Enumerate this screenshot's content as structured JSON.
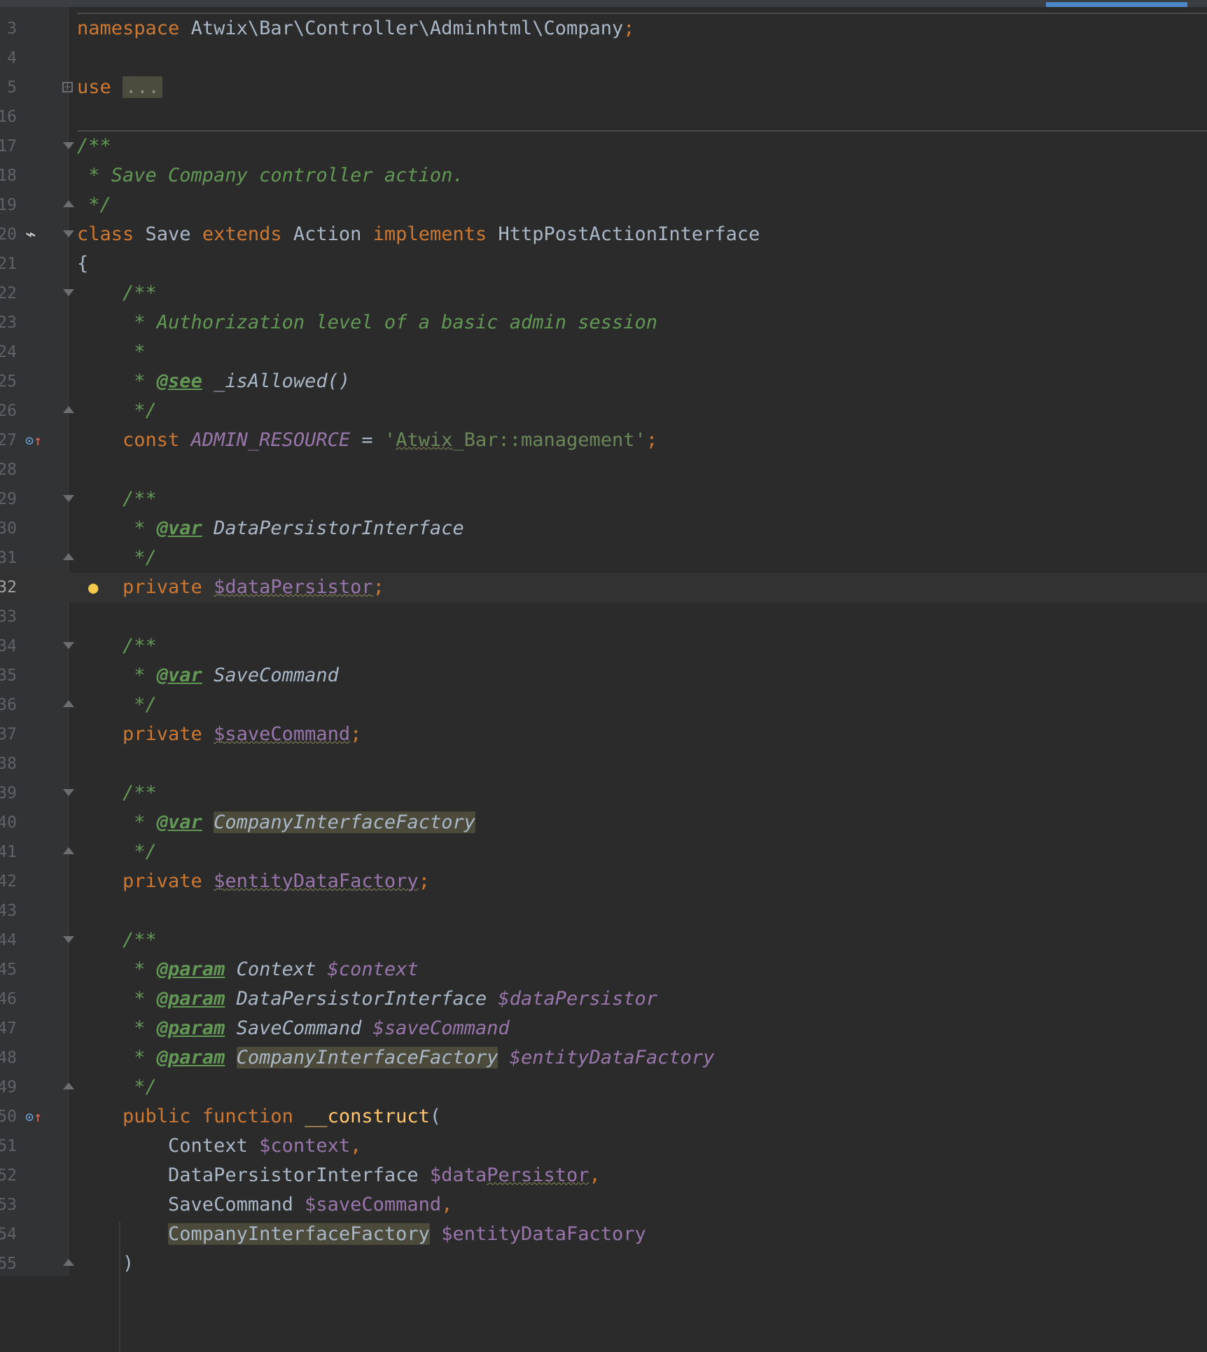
{
  "editor": {
    "lines": [
      {
        "n": "3",
        "parts": [
          [
            "kw",
            "namespace"
          ],
          [
            "t",
            " Atwix\\Bar\\Controller\\Adminhtml\\Company"
          ],
          [
            "kw",
            ";"
          ]
        ]
      },
      {
        "n": "4",
        "parts": []
      },
      {
        "n": "5",
        "fold": "box",
        "parts": [
          [
            "kw",
            "use"
          ],
          [
            "t",
            " "
          ],
          [
            "foldbox",
            "..."
          ]
        ]
      },
      {
        "n": "16",
        "parts": []
      },
      {
        "n": "17",
        "fold": "open",
        "parts": [
          [
            "cm",
            "/**"
          ]
        ]
      },
      {
        "n": "18",
        "parts": [
          [
            "cm",
            " * Save Company controller action."
          ]
        ]
      },
      {
        "n": "19",
        "fold": "close",
        "parts": [
          [
            "cm",
            " */"
          ]
        ]
      },
      {
        "n": "20",
        "icon": "plug-icon",
        "fold": "open",
        "parts": [
          [
            "kw",
            "class"
          ],
          [
            "t",
            " Save "
          ],
          [
            "kw",
            "extends"
          ],
          [
            "t",
            " Action "
          ],
          [
            "kw",
            "implements"
          ],
          [
            "t",
            " HttpPostActionInterface"
          ]
        ]
      },
      {
        "n": "21",
        "parts": [
          [
            "t",
            "{"
          ]
        ]
      },
      {
        "n": "22",
        "fold": "open",
        "parts": [
          [
            "cm",
            "    /**"
          ]
        ]
      },
      {
        "n": "23",
        "parts": [
          [
            "cm",
            "     * Authorization level of a basic admin session"
          ]
        ]
      },
      {
        "n": "24",
        "parts": [
          [
            "cm",
            "     *"
          ]
        ]
      },
      {
        "n": "25",
        "parts": [
          [
            "cm",
            "     * "
          ],
          [
            "tag",
            "@see"
          ],
          [
            "doctype",
            " _isAllowed()"
          ]
        ]
      },
      {
        "n": "26",
        "fold": "close",
        "parts": [
          [
            "cm",
            "     */"
          ]
        ]
      },
      {
        "n": "27",
        "icon": "override-icon",
        "parts": [
          [
            "kw",
            "    const "
          ],
          [
            "cst",
            "ADMIN_RESOURCE"
          ],
          [
            "t",
            " = "
          ],
          [
            "str",
            "'"
          ],
          [
            "str squig",
            "Atwix"
          ],
          [
            "str",
            "_Bar::management'"
          ],
          [
            "kw",
            ";"
          ]
        ]
      },
      {
        "n": "28",
        "parts": []
      },
      {
        "n": "29",
        "fold": "open",
        "parts": [
          [
            "cm",
            "    /**"
          ]
        ]
      },
      {
        "n": "30",
        "parts": [
          [
            "cm",
            "     * "
          ],
          [
            "tag",
            "@var"
          ],
          [
            "doctype",
            " DataPersistorInterface"
          ]
        ]
      },
      {
        "n": "31",
        "fold": "close",
        "parts": [
          [
            "cm",
            "     */"
          ]
        ]
      },
      {
        "n": "32",
        "current": true,
        "bulb": true,
        "parts": [
          [
            "kw",
            "    private "
          ],
          [
            "var squig",
            "$dataPersistor"
          ],
          [
            "kw",
            ";"
          ]
        ]
      },
      {
        "n": "33",
        "parts": []
      },
      {
        "n": "34",
        "fold": "open",
        "parts": [
          [
            "cm",
            "    /**"
          ]
        ]
      },
      {
        "n": "35",
        "parts": [
          [
            "cm",
            "     * "
          ],
          [
            "tag",
            "@var"
          ],
          [
            "doctype",
            " SaveCommand"
          ]
        ]
      },
      {
        "n": "36",
        "fold": "close",
        "parts": [
          [
            "cm",
            "     */"
          ]
        ]
      },
      {
        "n": "37",
        "parts": [
          [
            "kw",
            "    private "
          ],
          [
            "var squig",
            "$saveCommand"
          ],
          [
            "kw",
            ";"
          ]
        ]
      },
      {
        "n": "38",
        "parts": []
      },
      {
        "n": "39",
        "fold": "open",
        "parts": [
          [
            "cm",
            "    /**"
          ]
        ]
      },
      {
        "n": "40",
        "parts": [
          [
            "cm",
            "     * "
          ],
          [
            "tag",
            "@var"
          ],
          [
            "t",
            " "
          ],
          [
            "doctype hl",
            "CompanyInterfaceFactory"
          ]
        ]
      },
      {
        "n": "41",
        "fold": "close",
        "parts": [
          [
            "cm",
            "     */"
          ]
        ]
      },
      {
        "n": "42",
        "parts": [
          [
            "kw",
            "    private "
          ],
          [
            "var squig",
            "$entityDataFactory"
          ],
          [
            "kw",
            ";"
          ]
        ]
      },
      {
        "n": "43",
        "parts": []
      },
      {
        "n": "44",
        "fold": "open",
        "parts": [
          [
            "cm",
            "    /**"
          ]
        ]
      },
      {
        "n": "45",
        "parts": [
          [
            "cm",
            "     * "
          ],
          [
            "tag",
            "@param"
          ],
          [
            "doctype",
            " Context "
          ],
          [
            "cst",
            "$context"
          ]
        ]
      },
      {
        "n": "46",
        "parts": [
          [
            "cm",
            "     * "
          ],
          [
            "tag",
            "@param"
          ],
          [
            "doctype",
            " DataPersistorInterface "
          ],
          [
            "cst",
            "$dataPersistor"
          ]
        ]
      },
      {
        "n": "47",
        "parts": [
          [
            "cm",
            "     * "
          ],
          [
            "tag",
            "@param"
          ],
          [
            "doctype",
            " SaveCommand "
          ],
          [
            "cst",
            "$saveCommand"
          ]
        ]
      },
      {
        "n": "48",
        "parts": [
          [
            "cm",
            "     * "
          ],
          [
            "tag",
            "@param"
          ],
          [
            "t",
            " "
          ],
          [
            "doctype hl",
            "CompanyInterfaceFactory"
          ],
          [
            "t",
            " "
          ],
          [
            "cst",
            "$entityDataFactory"
          ]
        ]
      },
      {
        "n": "49",
        "fold": "close",
        "parts": [
          [
            "cm",
            "     */"
          ]
        ]
      },
      {
        "n": "50",
        "icon": "override-icon",
        "parts": [
          [
            "kw",
            "    public function "
          ],
          [
            "fn",
            "__construct"
          ],
          [
            "t",
            "("
          ]
        ]
      },
      {
        "n": "51",
        "parts": [
          [
            "t",
            "        Context "
          ],
          [
            "var",
            "$context"
          ],
          [
            "kw",
            ","
          ]
        ]
      },
      {
        "n": "52",
        "parts": [
          [
            "t",
            "        DataPersistorInterface "
          ],
          [
            "var",
            "$data"
          ],
          [
            "var squig",
            "Persistor"
          ],
          [
            "kw",
            ","
          ]
        ]
      },
      {
        "n": "53",
        "parts": [
          [
            "t",
            "        SaveCommand "
          ],
          [
            "var",
            "$saveCommand"
          ],
          [
            "kw",
            ","
          ]
        ]
      },
      {
        "n": "54",
        "parts": [
          [
            "t",
            "        "
          ],
          [
            "t hl",
            "CompanyInterfaceFactory"
          ],
          [
            "t",
            " "
          ],
          [
            "var",
            "$entityDataFactory"
          ]
        ]
      },
      {
        "n": "55",
        "fold": "close",
        "parts": [
          [
            "t",
            "    )"
          ]
        ]
      }
    ]
  }
}
